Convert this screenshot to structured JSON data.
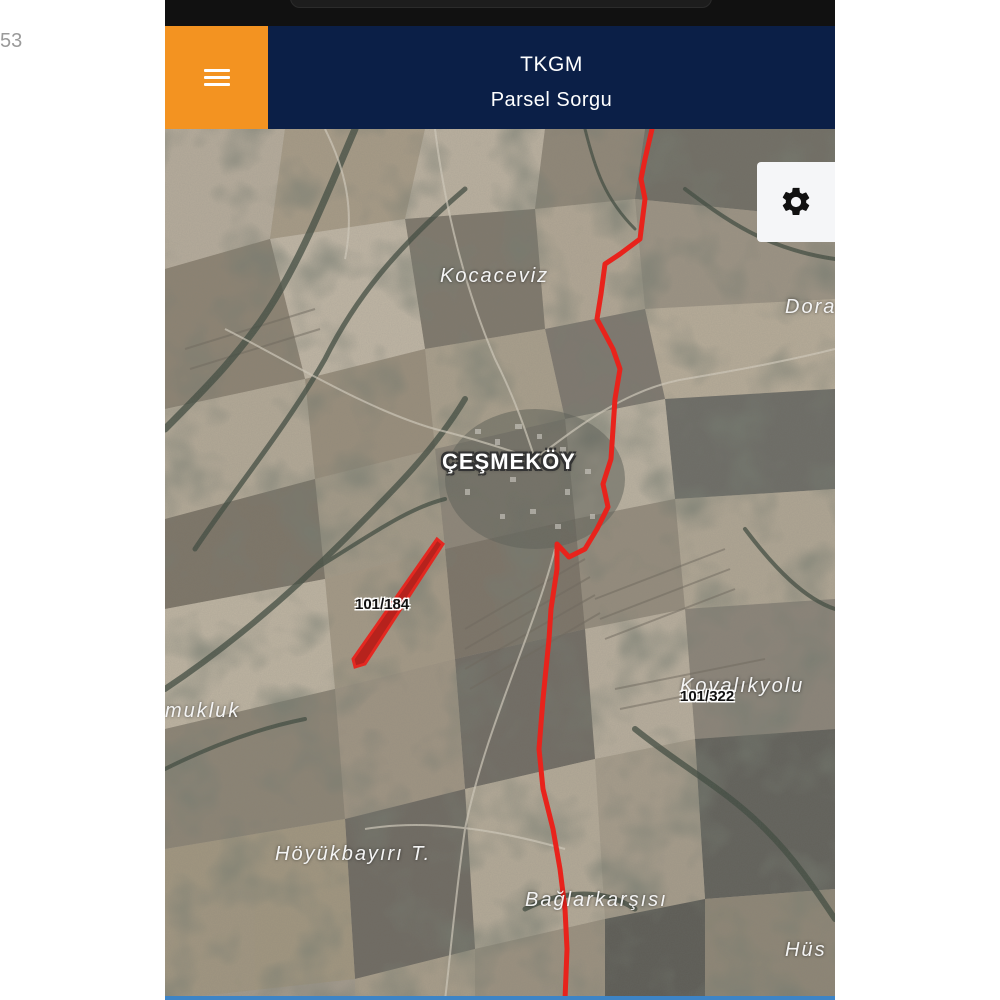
{
  "page": {
    "side_number": "53"
  },
  "header": {
    "title": "TKGM",
    "subtitle": "Parsel Sorgu",
    "accent_color": "#f39321",
    "bar_color": "#0b1f47"
  },
  "buttons": {
    "menu_icon": "hamburger-icon",
    "settings_icon": "gear-icon"
  },
  "map": {
    "basemap": "satellite",
    "boundary_color": "#e8231c",
    "village": "ÇEŞMEKÖY",
    "places": {
      "kocaceviz": "Kocaceviz",
      "dora": "Dora",
      "mukluk": "mukluk",
      "kovalik": "Kovalıkyolu",
      "hoyuk": "Höyükbayırı T.",
      "baglar": "Bağlarkarşısı",
      "hus": "Hüs"
    },
    "parcels": {
      "selected": "101/184",
      "other": "101/322"
    }
  }
}
